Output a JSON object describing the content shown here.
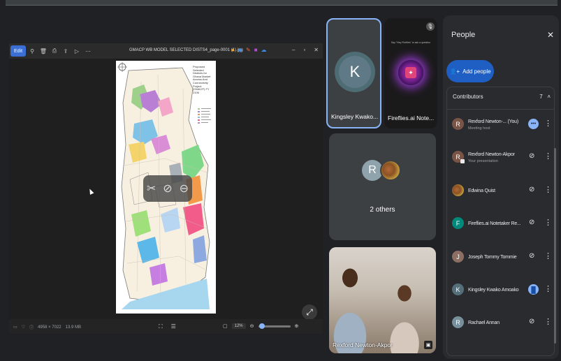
{
  "presentation": {
    "filename": "GMACP WB MODEL SELECTED DISTS4_page-0001 (1).jpg",
    "edit_label": "Edit",
    "map_title": "Proposed Selected Districts for Ghana Market Access And Connectivity Project (GMACP) FY 2106",
    "status_dims": "4958 × 7022",
    "status_size": "13.9 MB",
    "zoom_value": "12%"
  },
  "tiles": {
    "kingsley": {
      "name": "Kingsley Kwako...",
      "initial": "K"
    },
    "fireflies": {
      "name": "Fireflies.ai Note...",
      "caption": "Say \"Hey Fireflies\" to ask a question"
    },
    "others": {
      "initial": "R",
      "label": "2 others"
    },
    "video": {
      "name": "Rexford Newton-Akpor"
    }
  },
  "people": {
    "title": "People",
    "add_label": "Add people",
    "contributors_label": "Contributors",
    "contributors_count": "7",
    "list": [
      {
        "initial": "R",
        "name": "Rexford Newton-... (You)",
        "sub": "Meeting host",
        "color": "#795548",
        "status": "more"
      },
      {
        "initial": "R",
        "name": "Rexford Newton-Akpor",
        "sub": "Your presentation",
        "color": "#795548",
        "status": "muted"
      },
      {
        "initial": "",
        "name": "Edwina Quist",
        "sub": "",
        "color": "#8a6a2a",
        "status": "muted"
      },
      {
        "initial": "F",
        "name": "Fireflies.ai Notetaker Re...",
        "sub": "",
        "color": "#00897b",
        "status": "muted"
      },
      {
        "initial": "J",
        "name": "Joseph Tommy Tommie",
        "sub": "",
        "color": "#8d6e63",
        "status": "muted"
      },
      {
        "initial": "K",
        "name": "Kingsley Kwako Amoako",
        "sub": "",
        "color": "#546e7a",
        "status": "speaking"
      },
      {
        "initial": "R",
        "name": "Rachael Annan",
        "sub": "",
        "color": "#78909c",
        "status": "muted"
      }
    ]
  }
}
